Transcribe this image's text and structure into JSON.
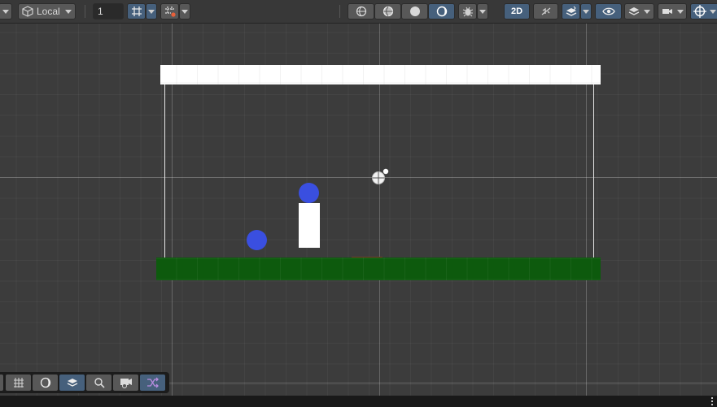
{
  "toolbar": {
    "pivot_mode_label": "Local",
    "grid_size_value": "1",
    "mode_2d_label": "2D",
    "icons": [
      "transform-dropdown-caret",
      "local-space-cube-icon",
      "dropdown-caret",
      "grid-snap-icon",
      "grid-visibility-icon",
      "wireframe-shading-icon",
      "shaded-wireframe-icon",
      "shaded-sphere-icon",
      "lighting-toggle-icon",
      "gizmos-bug-icon",
      "audio-mute-icon",
      "layers-icon",
      "visibility-eye-icon",
      "render-layers-icon",
      "camera-icon",
      "scene-gizmo-target-icon"
    ]
  },
  "overlay_toolbar": {
    "icons": [
      "grid-tool-icon",
      "lighting-preview-icon",
      "layer-stack-icon",
      "zoom-icon",
      "camera-preview-icon",
      "shuffle-icon"
    ]
  },
  "scene": {
    "objects": [
      "ceiling-bar",
      "floor-ground",
      "player-pillar",
      "ball-top",
      "ball-left",
      "light-gizmo"
    ],
    "colors": {
      "ball": "#3a4fe0",
      "ground": "#0d5a0d",
      "ceiling": "#ffffff",
      "pillar": "#ffffff",
      "background": "#3c3c3c"
    }
  }
}
